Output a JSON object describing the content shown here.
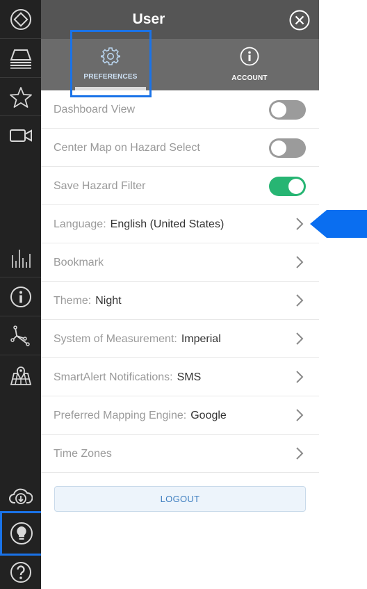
{
  "header": {
    "title": "User"
  },
  "tabs": [
    {
      "label": "PREFERENCES",
      "icon": "gear-icon",
      "selected": true
    },
    {
      "label": "ACCOUNT",
      "icon": "info-icon",
      "selected": false
    }
  ],
  "settings": {
    "dashboard_view": {
      "label": "Dashboard View",
      "on": false
    },
    "center_map": {
      "label": "Center Map on Hazard Select",
      "on": false
    },
    "save_filter": {
      "label": "Save Hazard Filter",
      "on": true
    },
    "language": {
      "label": "Language:",
      "value": "English (United States)"
    },
    "bookmark": {
      "label": "Bookmark"
    },
    "theme": {
      "label": "Theme:",
      "value": "Night"
    },
    "measurement": {
      "label": "System of Measurement:",
      "value": "Imperial"
    },
    "smartalert": {
      "label": "SmartAlert Notifications:",
      "value": "SMS"
    },
    "mapping_engine": {
      "label": "Preferred Mapping Engine:",
      "value": "Google"
    },
    "time_zones": {
      "label": "Time Zones"
    }
  },
  "logout_label": "LOGOUT",
  "rail": [
    "compass-diamond-icon",
    "layers-icon",
    "star-icon",
    "video-camera-icon",
    "bar-chart-icon",
    "info-icon",
    "route-nodes-icon",
    "map-pin-icon",
    "cloud-download-icon",
    "lightbulb-icon",
    "help-icon"
  ],
  "colors": {
    "accent": "#1a73e8",
    "toggle_on": "#27b573",
    "rail_bg": "#222222",
    "header_bg": "#555555"
  }
}
